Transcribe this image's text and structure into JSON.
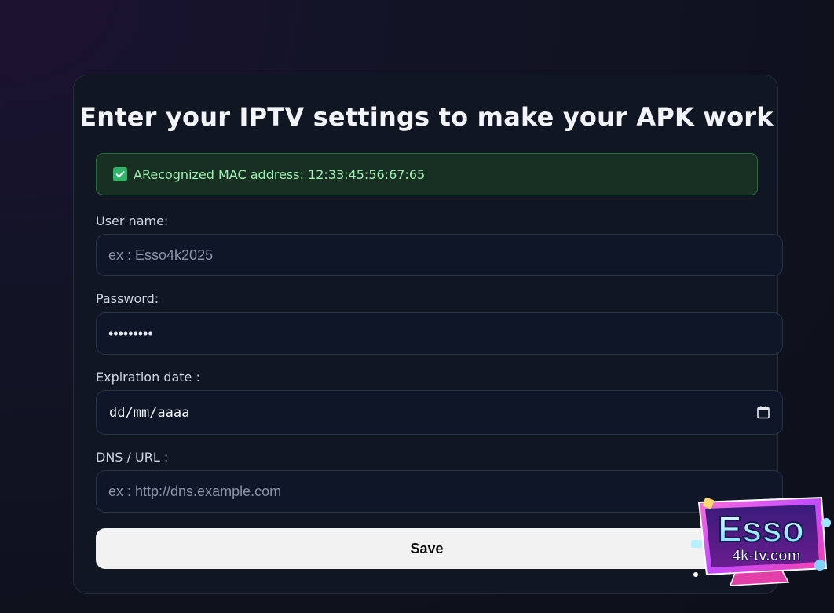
{
  "form": {
    "title": "Enter your IPTV settings to make your APK work",
    "mac_banner": {
      "icon": "check-box-icon",
      "text": "ARecognized MAC address: 12:33:45:56:67:65",
      "color": "#9ff0b5"
    },
    "fields": {
      "username": {
        "label": "User name:",
        "placeholder": "ex : Esso4k2025",
        "value": ""
      },
      "password": {
        "label": "Password:",
        "value": "123456789"
      },
      "expiration": {
        "label": "Expiration date :",
        "value": "dd/mm/aaaa",
        "icon": "calendar-icon"
      },
      "dns": {
        "label": "DNS / URL :",
        "placeholder": "ex : http://dns.example.com",
        "value": ""
      }
    },
    "save_label": "Save"
  },
  "logo": {
    "brand": "Esso",
    "domain": "4k-tv.com"
  },
  "colors": {
    "background": "#0e121d",
    "card": "#111722",
    "success_bg": "#173021",
    "success_border": "#2b6a3f",
    "button_bg": "#f2f2f2"
  }
}
